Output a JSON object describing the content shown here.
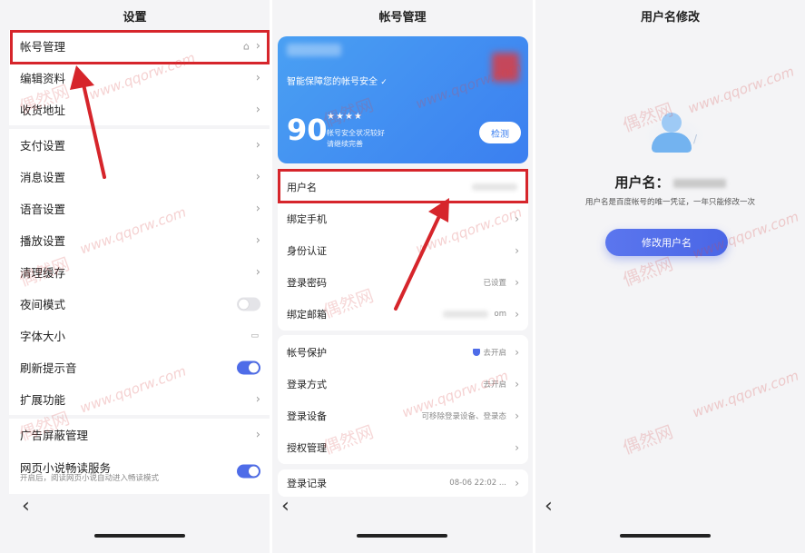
{
  "left_panel": {
    "title": "设置",
    "items": [
      {
        "label": "帐号管理",
        "type": "home"
      },
      {
        "label": "编辑资料",
        "type": "chevron"
      },
      {
        "label": "收货地址",
        "type": "chevron"
      },
      {
        "label": "支付设置",
        "type": "chevron"
      },
      {
        "label": "消息设置",
        "type": "chevron"
      },
      {
        "label": "语音设置",
        "type": "chevron"
      },
      {
        "label": "播放设置",
        "type": "chevron"
      },
      {
        "label": "清理缓存",
        "type": "chevron"
      },
      {
        "label": "夜间模式",
        "type": "toggle",
        "on": false
      },
      {
        "label": "字体大小",
        "type": "font"
      },
      {
        "label": "刷新提示音",
        "type": "toggle",
        "on": true
      },
      {
        "label": "扩展功能",
        "type": "chevron"
      },
      {
        "label": "广告屏蔽管理",
        "type": "chevron"
      },
      {
        "label": "网页小说畅读服务",
        "sub": "开启后，阅读网页小说自动进入畅读模式",
        "type": "toggle",
        "on": true
      }
    ]
  },
  "middle_panel": {
    "title": "帐号管理",
    "card": {
      "tagline": "智能保障您的帐号安全",
      "score": "90",
      "stars": "★★★★",
      "status_line1": "帐号安全状况较好",
      "status_line2": "请继续完善",
      "detect_label": "检测"
    },
    "group1": [
      {
        "label": "用户名",
        "value": ""
      },
      {
        "label": "绑定手机",
        "value": ""
      },
      {
        "label": "身份认证",
        "value": ""
      },
      {
        "label": "登录密码",
        "value": "已设置"
      },
      {
        "label": "绑定邮箱",
        "value": "om"
      }
    ],
    "group2": [
      {
        "label": "帐号保护",
        "value": "去开启"
      },
      {
        "label": "登录方式",
        "value": "去开启"
      },
      {
        "label": "登录设备",
        "value": "可移除登录设备、登录态"
      },
      {
        "label": "授权管理",
        "value": ""
      }
    ],
    "group3": [
      {
        "label": "登录记录",
        "value": "08-06 22:02 ..."
      }
    ]
  },
  "right_panel": {
    "title": "用户名修改",
    "username_label": "用户名：",
    "hint": "用户名是百度帐号的唯一凭证，一年只能修改一次",
    "button_label": "修改用户名"
  },
  "nav": {
    "back_glyph": "‹"
  },
  "watermarks": {
    "latin": "www.qqorw.com",
    "cn": "偶然网"
  },
  "colors": {
    "highlight": "#d6252b",
    "accent": "#4e6ce8",
    "card": "#3b7ff0"
  }
}
